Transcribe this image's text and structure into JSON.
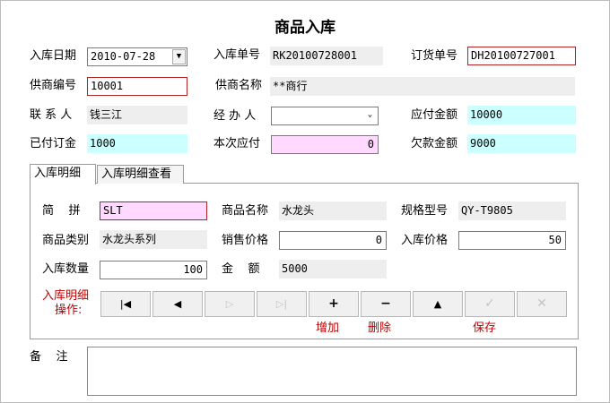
{
  "title": "商品入库",
  "header": {
    "in_date_label": "入库日期",
    "in_date_value": "2010-07-28",
    "in_no_label": "入库单号",
    "in_no_value": "RK20100728001",
    "order_no_label": "订货单号",
    "order_no_value": "DH20100727001",
    "supplier_code_label": "供商编号",
    "supplier_code_value": "10001",
    "supplier_name_label": "供商名称",
    "supplier_name_value": "**商行",
    "contact_label": "联 系 人",
    "contact_value": "钱三江",
    "handler_label": "经 办 人",
    "handler_value": "",
    "payable_label": "应付金额",
    "payable_value": "10000",
    "paid_deposit_label": "已付订金",
    "paid_deposit_value": "1000",
    "current_pay_label": "本次应付",
    "current_pay_value": "0",
    "owed_label": "欠款金额",
    "owed_value": "9000"
  },
  "tabs": [
    {
      "label": "入库明细",
      "active": true
    },
    {
      "label": "入库明细查看",
      "active": false
    }
  ],
  "detail": {
    "pinyin_label": "简    拼",
    "pinyin_value": "SLT",
    "product_name_label": "商品名称",
    "product_name_value": "水龙头",
    "spec_label": "规格型号",
    "spec_value": "QY-T9805",
    "category_label": "商品类别",
    "category_value": "水龙头系列",
    "sale_price_label": "销售价格",
    "sale_price_value": "0",
    "in_price_label": "入库价格",
    "in_price_value": "50",
    "qty_label": "入库数量",
    "qty_value": "100",
    "amount_label": "金    额",
    "amount_value": "5000",
    "ops_label_line1": "入库明细",
    "ops_label_line2": "操作:"
  },
  "nav": {
    "first": "|◀",
    "prev": "◀",
    "next": "▷",
    "last": "▷|",
    "add": "+",
    "delete": "−",
    "up": "▲",
    "save": "✓",
    "cancel": "✕",
    "add_label": "增加",
    "delete_label": "删除",
    "save_label": "保存"
  },
  "memo_label": "备    注",
  "memo_value": ""
}
